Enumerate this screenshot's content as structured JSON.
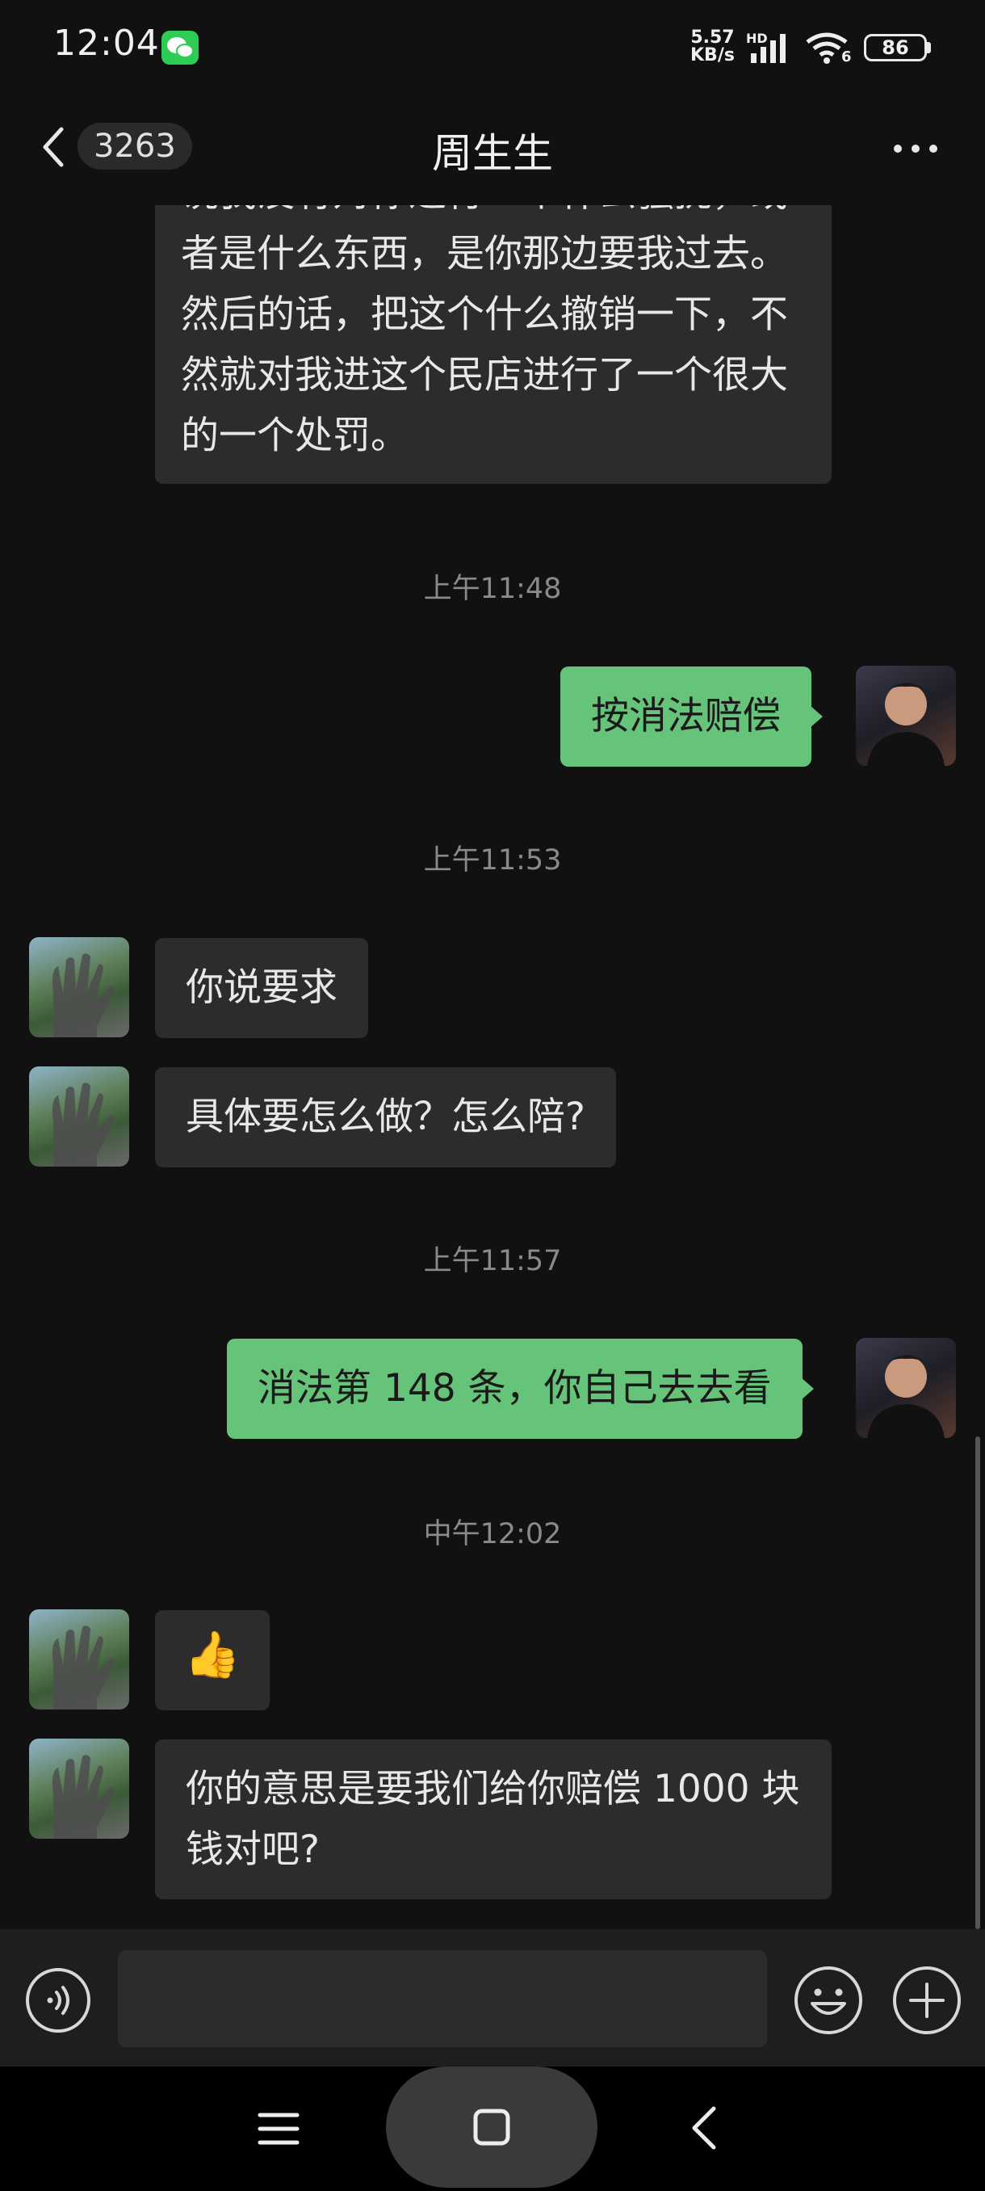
{
  "status_bar": {
    "time": "12:04",
    "net_speed_value": "5.57",
    "net_speed_unit": "KB/s",
    "hd": "HD",
    "wifi_label": "6",
    "battery": "86"
  },
  "header": {
    "unread_count": "3263",
    "title": "周生生",
    "back_icon": "chevron-left-icon",
    "more_icon": "more-dots-icon"
  },
  "messages": [
    {
      "side": "in",
      "text": "说我没有对你进行一个什么骚扰，或者是什么东西，是你那边要我过去。然后的话，把这个什么撤销一下，不然就对我进这个民店进行了一个很大的一个处罚。"
    },
    {
      "type": "timestamp",
      "text": "上午11:48"
    },
    {
      "side": "out",
      "text": "按消法赔偿"
    },
    {
      "type": "timestamp",
      "text": "上午11:53"
    },
    {
      "side": "in",
      "text": "你说要求"
    },
    {
      "side": "in",
      "text": "具体要怎么做？怎么陪?"
    },
    {
      "type": "timestamp",
      "text": "上午11:57"
    },
    {
      "side": "out",
      "text": "消法第 148 条，你自己去去看"
    },
    {
      "type": "timestamp",
      "text": "中午12:02"
    },
    {
      "side": "in",
      "type": "emoji",
      "text": "👍"
    },
    {
      "side": "in",
      "text": "你的意思是要我们给你赔偿 1000 块钱对吧?"
    }
  ],
  "input_bar": {
    "voice_icon": "voice-icon",
    "emoji_icon": "emoji-icon",
    "plus_icon": "plus-icon"
  },
  "colors": {
    "background": "#111111",
    "incoming_bubble": "#2c2c2c",
    "outgoing_bubble": "#66c37a",
    "wechat_green": "#2ecc55"
  }
}
